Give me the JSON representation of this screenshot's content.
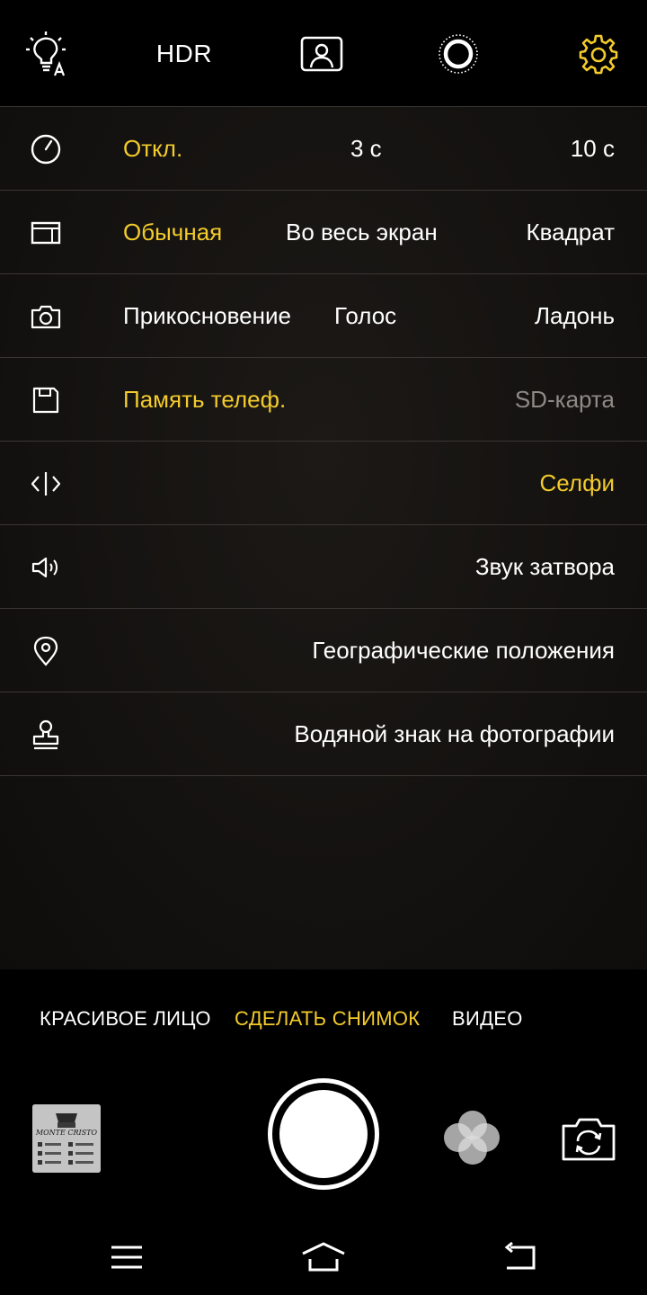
{
  "topbar": {
    "hdr_label": "HDR",
    "icons": [
      "auto-flash-icon",
      "portrait-icon",
      "live-photo-icon",
      "settings-gear-icon"
    ],
    "accent_color": "#f3cb2c"
  },
  "settings": {
    "timer": {
      "icon": "timer-icon",
      "options": [
        "Откл.",
        "3 с",
        "10 с"
      ],
      "selected": "Откл."
    },
    "aspect": {
      "icon": "aspect-ratio-icon",
      "options": [
        "Обычная",
        "Во весь экран",
        "Квадрат"
      ],
      "selected": "Обычная"
    },
    "capture": {
      "icon": "camera-capture-icon",
      "options": [
        "Прикосновение",
        "Голос",
        "Ладонь"
      ]
    },
    "storage": {
      "icon": "storage-icon",
      "options": [
        "Память телеф.",
        "SD-карта"
      ],
      "selected": "Память телеф.",
      "disabled": "SD-карта"
    },
    "mirror": {
      "icon": "mirror-icon",
      "label": "Селфи",
      "active": true
    },
    "shutter_sound": {
      "icon": "speaker-icon",
      "label": "Звук затвора"
    },
    "location": {
      "icon": "location-pin-icon",
      "label": "Географические положения"
    },
    "watermark": {
      "icon": "stamp-icon",
      "label": "Водяной знак на фотографии"
    }
  },
  "modes": {
    "items": [
      "КРАСИВОЕ ЛИЦО",
      "СДЕЛАТЬ СНИМОК",
      "ВИДЕО"
    ],
    "selected": "СДЕЛАТЬ СНИМОК"
  },
  "controls": {
    "gallery_thumb_text": "MONTE CRISTO",
    "icons": [
      "gallery-thumbnail",
      "shutter-button",
      "filters-icon",
      "switch-camera-icon"
    ]
  },
  "navbar": {
    "icons": [
      "menu-icon",
      "home-icon",
      "back-icon"
    ]
  }
}
